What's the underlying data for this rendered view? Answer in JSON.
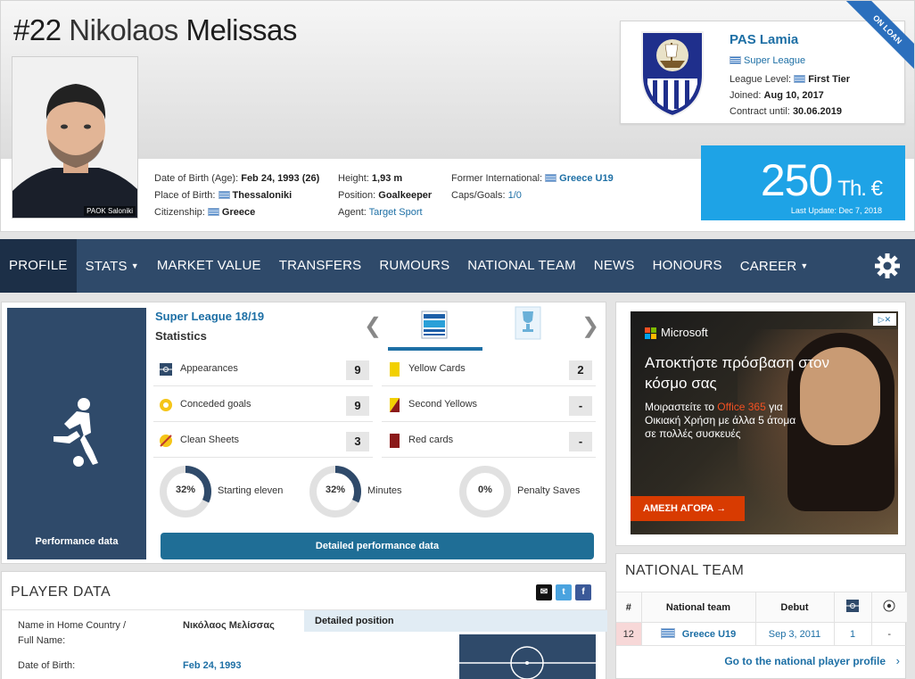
{
  "player": {
    "number": "#22",
    "first_name": "Nikolaos",
    "last_name": "Melissas",
    "photo_credit": "PAOK Saloniki"
  },
  "info": {
    "dob_label": "Date of Birth (Age):",
    "dob_value": "Feb 24, 1993 (26)",
    "pob_label": "Place of Birth:",
    "pob_value": "Thessaloniki",
    "citizenship_label": "Citizenship:",
    "citizenship_value": "Greece",
    "height_label": "Height:",
    "height_value": "1,93 m",
    "position_label": "Position:",
    "position_value": "Goalkeeper",
    "agent_label": "Agent:",
    "agent_value": "Target Sport",
    "former_label": "Former International:",
    "former_value": "Greece U19",
    "caps_label": "Caps/Goals:",
    "caps_value": "1/0"
  },
  "club": {
    "name": "PAS Lamia",
    "league": "Super League",
    "level_label": "League Level:",
    "level_value": "First Tier",
    "joined_label": "Joined:",
    "joined_value": "Aug 10, 2017",
    "contract_label": "Contract until:",
    "contract_value": "30.06.2019",
    "ribbon": "ON LOAN"
  },
  "market_value": {
    "amount": "250",
    "unit": "Th. €",
    "last_update": "Last Update: Dec 7, 2018"
  },
  "nav": {
    "items": [
      {
        "label": "PROFILE"
      },
      {
        "label": "STATS"
      },
      {
        "label": "MARKET VALUE"
      },
      {
        "label": "TRANSFERS"
      },
      {
        "label": "RUMOURS"
      },
      {
        "label": "NATIONAL TEAM"
      },
      {
        "label": "NEWS"
      },
      {
        "label": "HONOURS"
      },
      {
        "label": "CAREER"
      }
    ]
  },
  "stats": {
    "side_label": "Performance data",
    "league": "Super League 18/19",
    "subtitle": "Statistics",
    "rows_left": [
      {
        "label": "Appearances",
        "value": "9"
      },
      {
        "label": "Conceded goals",
        "value": "9"
      },
      {
        "label": "Clean Sheets",
        "value": "3"
      }
    ],
    "rows_right": [
      {
        "label": "Yellow Cards",
        "value": "2"
      },
      {
        "label": "Second Yellows",
        "value": "-"
      },
      {
        "label": "Red cards",
        "value": "-"
      }
    ],
    "donuts": [
      {
        "pct": "32%",
        "label": "Starting eleven",
        "fraction": 0.32
      },
      {
        "pct": "32%",
        "label": "Minutes",
        "fraction": 0.32
      },
      {
        "pct": "0%",
        "label": "Penalty Saves",
        "fraction": 0
      }
    ],
    "detail_button": "Detailed performance data"
  },
  "ad": {
    "brand": "Microsoft",
    "headline": "Αποκτήστε πρόσβαση στον κόσμο σας",
    "body_pre": "Μοιραστείτε το",
    "body_product": "Office 365",
    "body_post": "για Οικιακή Χρήση με άλλα 5 άτομα σε πολλές συσκευές",
    "cta": "ΑΜΕΣΗ ΑΓΟΡΑ →"
  },
  "player_data": {
    "title": "PLAYER DATA",
    "name_label": "Name in Home Country / Full Name:",
    "name_value": "Νικόλαος Μελίσσας",
    "dob_label": "Date of Birth:",
    "dob_value": "Feb 24, 1993",
    "detailed_position": "Detailed position"
  },
  "national_team": {
    "title": "NATIONAL TEAM",
    "headers": {
      "num": "#",
      "team": "National team",
      "debut": "Debut"
    },
    "rows": [
      {
        "num": "12",
        "team": "Greece U19",
        "debut": "Sep 3, 2011",
        "apps": "1",
        "goals": "-"
      }
    ],
    "link": "Go to the national player profile"
  },
  "colors": {
    "nav": "#2f4a6a",
    "nav_active": "#1c2f47",
    "link": "#1d6fa5",
    "value_box": "#1ea3e6"
  }
}
